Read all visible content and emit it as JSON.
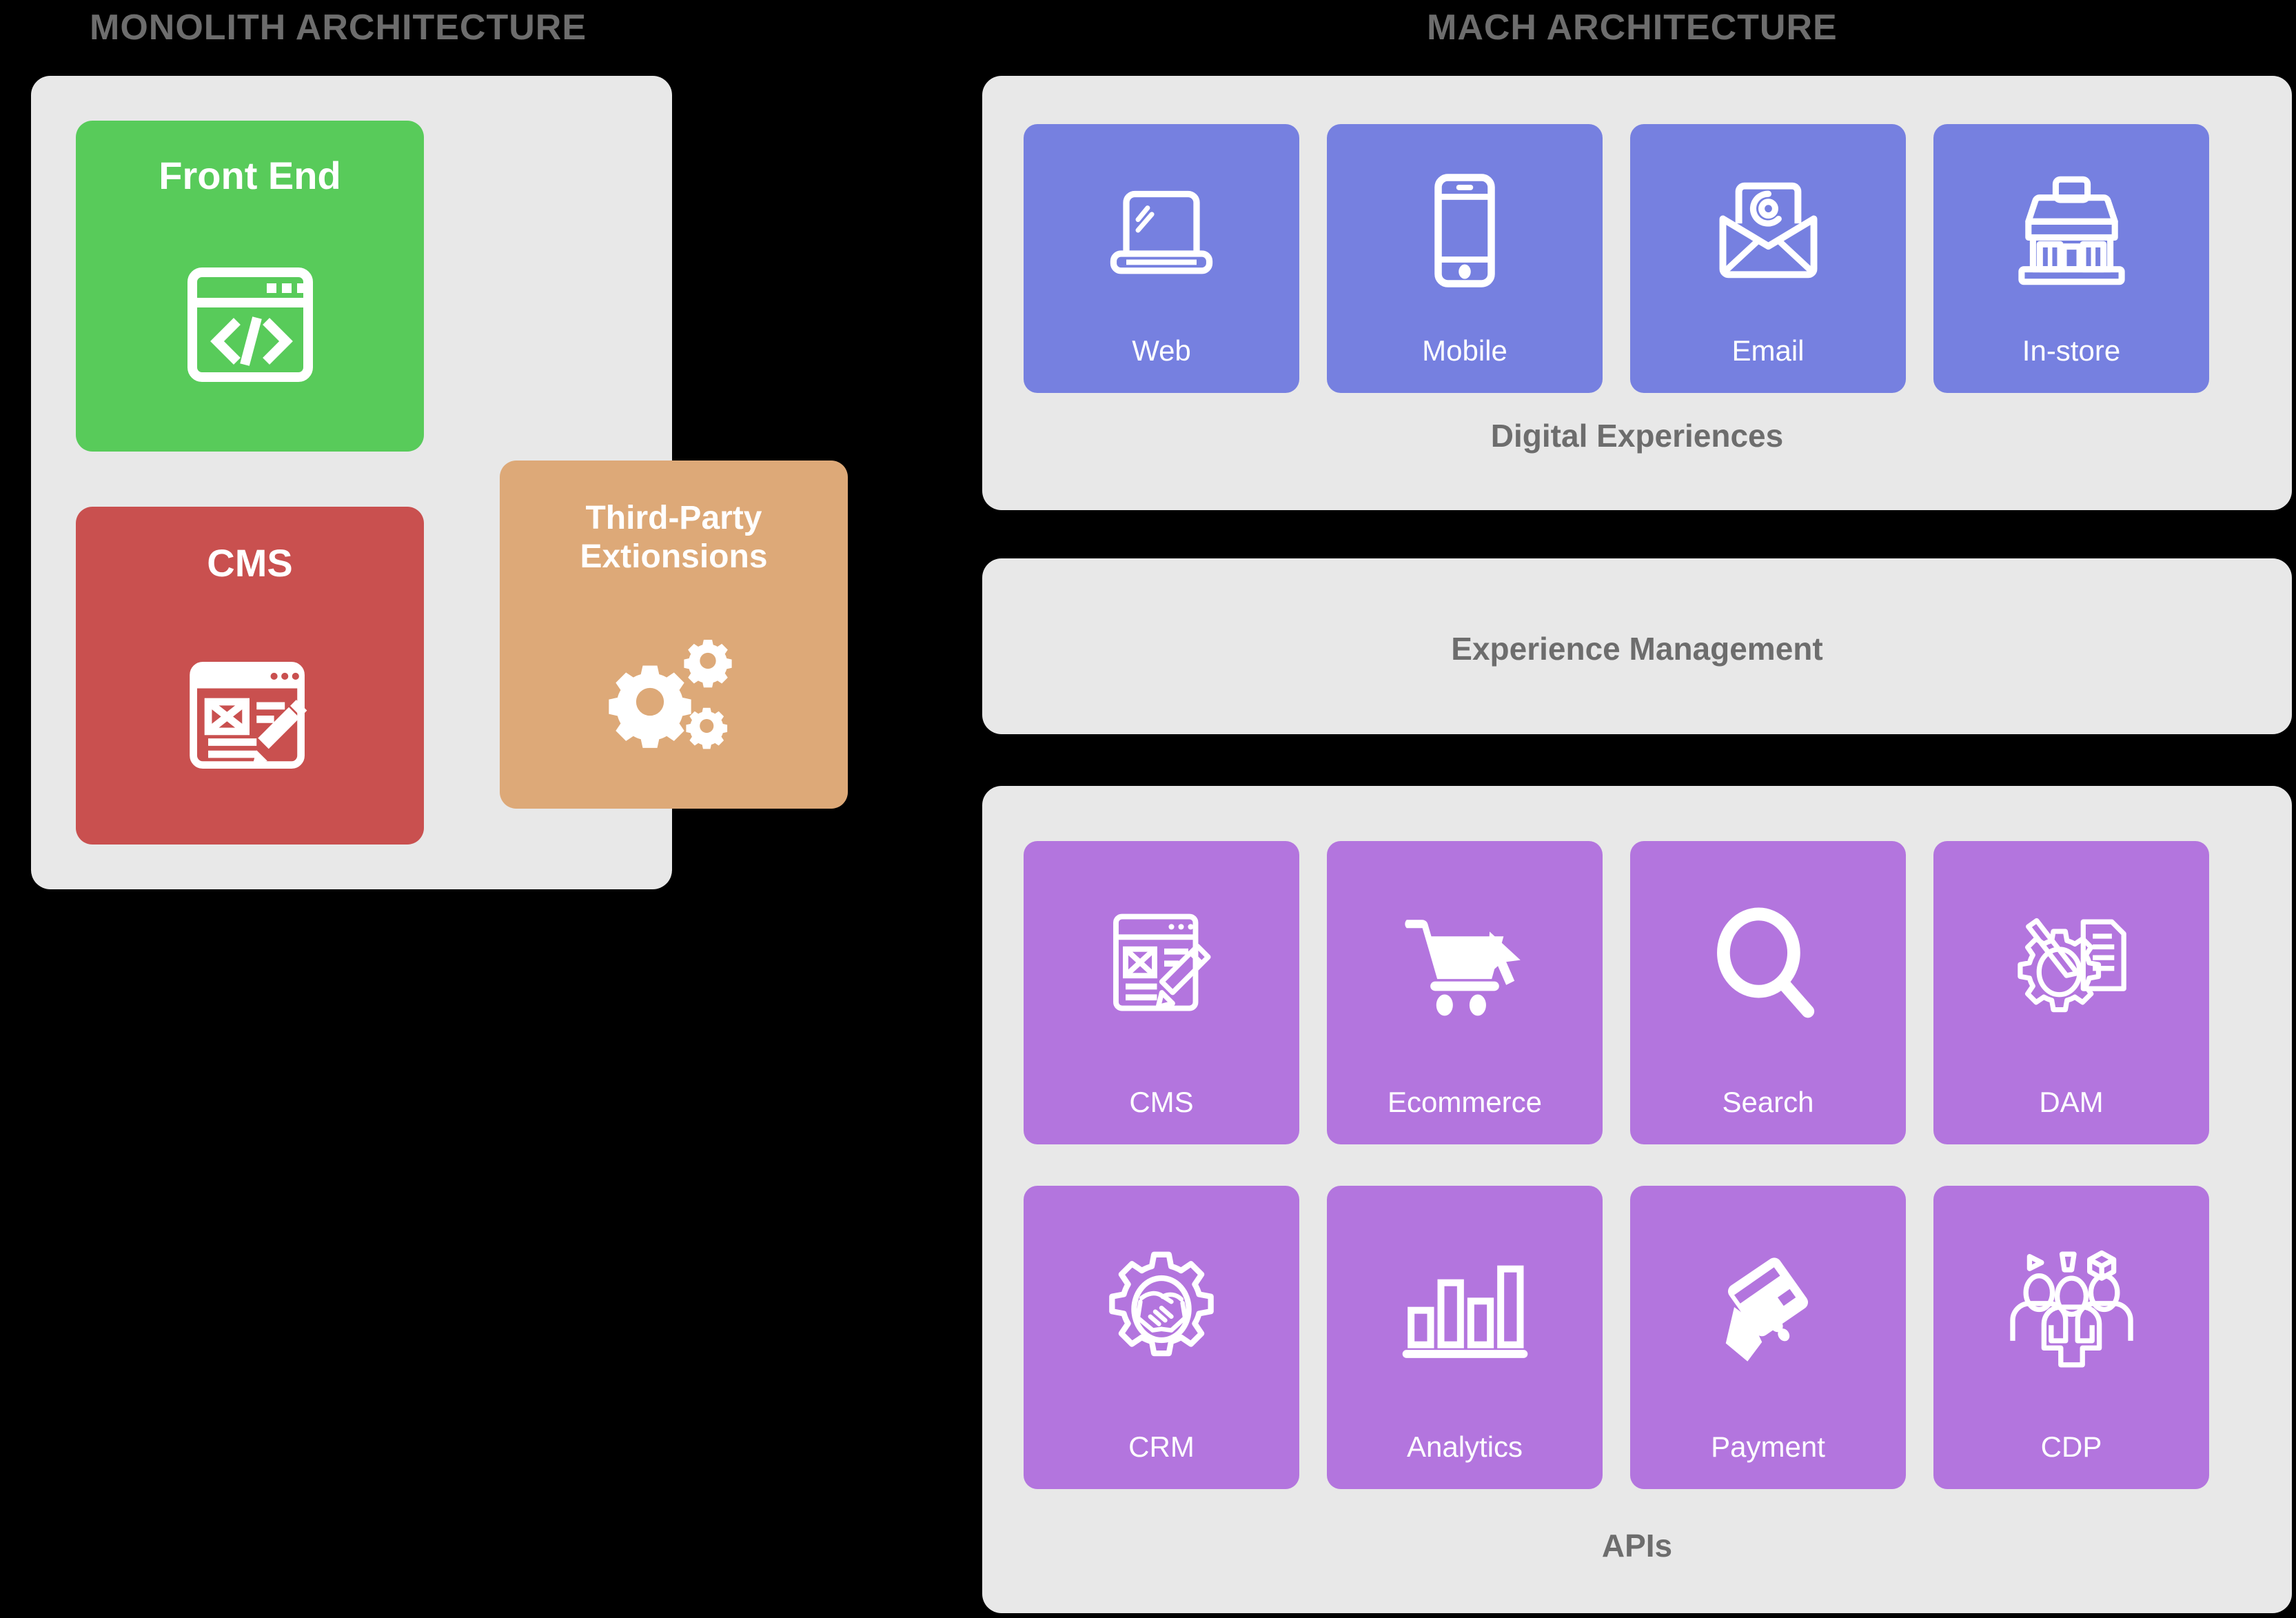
{
  "monolith": {
    "title": "MONOLITH ARCHITECTURE",
    "panel_color": "#e8e8e8",
    "cards": [
      {
        "label": "Front End",
        "icon": "code-window-icon",
        "color": "#58cb5a"
      },
      {
        "label": "CMS",
        "icon": "content-editor-icon",
        "color": "#c9504f"
      },
      {
        "label": "Third-Party\nExtionsions",
        "icon": "gears-icon",
        "color": "#dda978"
      }
    ]
  },
  "mach": {
    "title": "MACH ARCHITECTURE",
    "panel_color": "#e8e8e8",
    "digital_experiences": {
      "label": "Digital Experiences",
      "tile_color": "#7680e0",
      "tiles": [
        {
          "label": "Web",
          "icon": "laptop-icon"
        },
        {
          "label": "Mobile",
          "icon": "smartphone-icon"
        },
        {
          "label": "Email",
          "icon": "envelope-at-icon"
        },
        {
          "label": "In-store",
          "icon": "storefront-icon"
        }
      ]
    },
    "experience_management": {
      "label": "Experience Management"
    },
    "apis": {
      "label": "APIs",
      "tile_color": "#b375de",
      "tiles_row1": [
        {
          "label": "CMS",
          "icon": "content-editor-icon"
        },
        {
          "label": "Ecommerce",
          "icon": "shopping-cart-cursor-icon"
        },
        {
          "label": "Search",
          "icon": "magnifier-icon"
        },
        {
          "label": "DAM",
          "icon": "gear-pencil-document-icon"
        }
      ],
      "tiles_row2": [
        {
          "label": "CRM",
          "icon": "gear-handshake-icon"
        },
        {
          "label": "Analytics",
          "icon": "bar-chart-icon"
        },
        {
          "label": "Payment",
          "icon": "hand-credit-card-icon"
        },
        {
          "label": "CDP",
          "icon": "people-group-icon"
        }
      ]
    }
  },
  "colors": {
    "background": "#000000",
    "panel": "#e8e8e8",
    "title_text": "#6d6d6d",
    "green": "#58cb5a",
    "red": "#c9504f",
    "tan": "#dda978",
    "blue_purple": "#7680e0",
    "light_purple": "#b375de"
  }
}
